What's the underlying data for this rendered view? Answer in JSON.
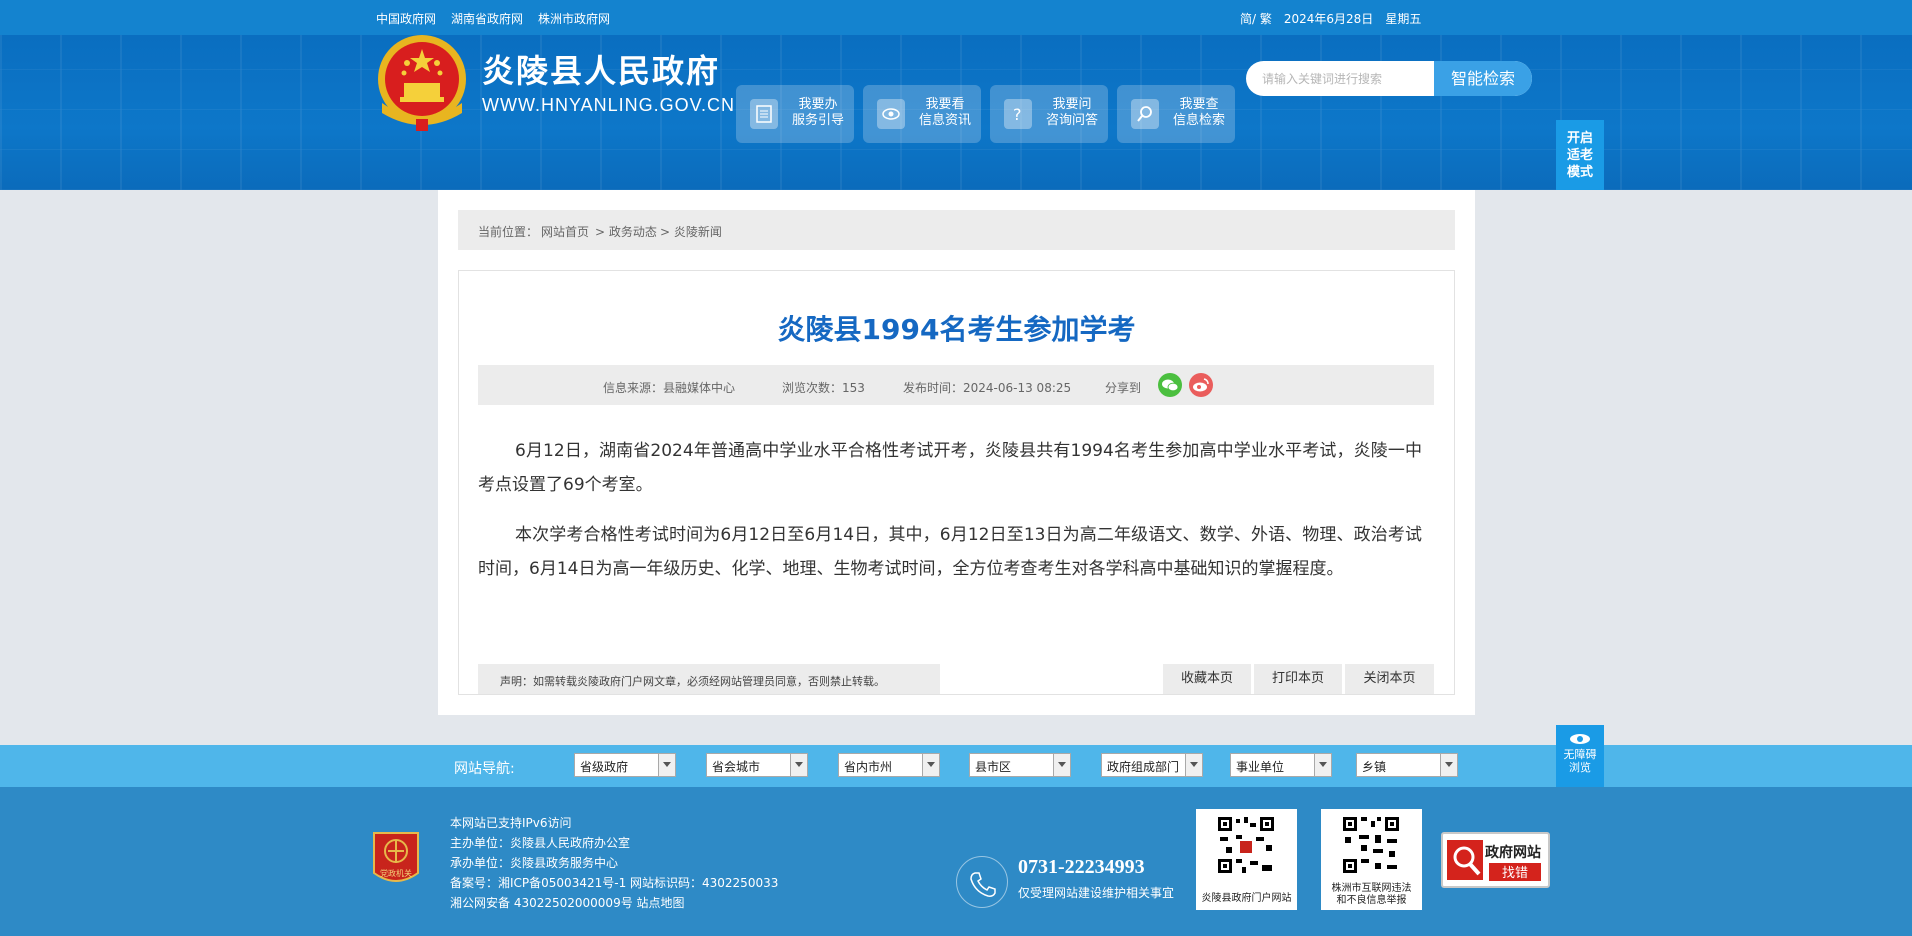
{
  "topbar": {
    "links": [
      "中国政府网",
      "湖南省政府网",
      "株洲市政府网"
    ],
    "lang": "简/ 繁",
    "date": "2024年6月28日",
    "weekday": "星期五"
  },
  "header": {
    "title": "炎陵县人民政府",
    "url": "WWW.HNYANLING.GOV.CN",
    "services": [
      {
        "line1": "我要办",
        "line2": "服务引导",
        "icon": "document-icon"
      },
      {
        "line1": "我要看",
        "line2": "信息资讯",
        "icon": "eye-icon"
      },
      {
        "line1": "我要问",
        "line2": "咨询问答",
        "icon": "question-icon"
      },
      {
        "line1": "我要查",
        "line2": "信息检索",
        "icon": "search-icon"
      }
    ],
    "search_placeholder": "请输入关键词进行搜索",
    "search_button": "智能检索",
    "elder_mode": [
      "开启",
      "适老",
      "模式"
    ]
  },
  "breadcrumb": {
    "label": "当前位置：",
    "items": [
      "网站首页",
      "> 政务动态",
      "> 炎陵新闻"
    ]
  },
  "article": {
    "title": "炎陵县1994名考生参加学考",
    "source": "信息来源：县融媒体中心",
    "views": "浏览次数：153",
    "published": "发布时间：2024-06-13 08:25",
    "share": "分享到",
    "paragraphs": [
      "6月12日，湖南省2024年普通高中学业水平合格性考试开考，炎陵县共有1994名考生参加高中学业水平考试，炎陵一中考点设置了69个考室。",
      "本次学考合格性考试时间为6月12日至6月14日，其中，6月12日至13日为高二年级语文、数学、外语、物理、政治考试时间，6月14日为高一年级历史、化学、地理、生物考试时间，全方位考查考生对各学科高中基础知识的掌握程度。"
    ],
    "notice": "声明：如需转载炎陵政府门户网文章，必须经网站管理员同意，否则禁止转载。",
    "actions": [
      "收藏本页",
      "打印本页",
      "关闭本页"
    ]
  },
  "nav": {
    "label": "网站导航:",
    "selects": [
      "省级政府",
      "省会城市",
      "省内市州",
      "县市区",
      "政府组成部门",
      "事业单位",
      "乡镇"
    ],
    "accessibility": [
      "无障碍",
      "浏览"
    ]
  },
  "footer": {
    "lines": [
      "本网站已支持IPv6访问",
      "主办单位：炎陵县人民政府办公室",
      "承办单位：炎陵县政务服务中心",
      "备案号：湘ICP备05003421号-1 网站标识码：4302250033",
      "湘公网安备 43022502000009号 站点地图"
    ],
    "phone": "0731-22234993",
    "phone_note": "仅受理网站建设维护相关事宜",
    "qr1_caption": "炎陵县政府门户网站",
    "qr2_caption": [
      "株洲市互联网违法",
      "和不良信息举报"
    ],
    "fix_line1": "政府网站",
    "fix_line2": "找错",
    "dj_text": "党政机关"
  },
  "colors": {
    "topbar": "#1483cf",
    "header": "#0d77c9",
    "title": "#1568c2",
    "navbar": "#4fb6ea",
    "footer": "#2e8ac6"
  }
}
